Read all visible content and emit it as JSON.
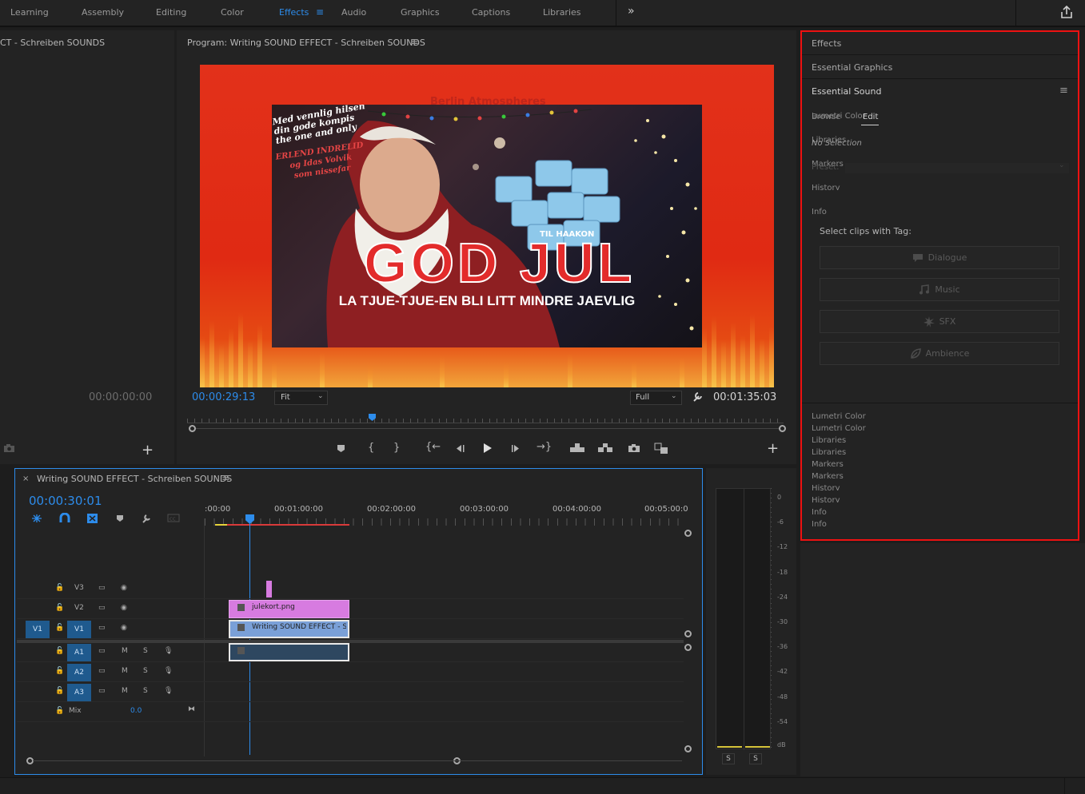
{
  "workspaces": {
    "tabs": [
      "Learning",
      "Assembly",
      "Editing",
      "Color",
      "Effects",
      "Audio",
      "Graphics",
      "Captions",
      "Libraries"
    ],
    "active": "Effects",
    "more_glyph": "»",
    "share_icon": "share-icon"
  },
  "source_panel": {
    "title": "CT - Schreiben SOUNDS",
    "timecode": "00:00:00:00"
  },
  "program": {
    "title": "Program: Writing SOUND EFFECT - Schreiben SOUNDS",
    "timecode": "00:00:29:13",
    "fit": "Fit",
    "resolution": "Full",
    "duration": "00:01:35:03",
    "image": {
      "top_text": "Berlin Atmospheres",
      "greeting_lines": [
        "Med vennlig hilsen",
        "din gode kompis",
        "the one and only"
      ],
      "names_lines": [
        "ERLEND INDRELID",
        "og Idas Volvik",
        "som nissefar"
      ],
      "to_text": "TIL HAAKON",
      "headline": "GOD JUL",
      "subline": "LA TJUE-TJUE-EN BLI LITT MINDRE JAEVLIG"
    }
  },
  "timeline": {
    "sequence": "Writing SOUND EFFECT - Schreiben SOUNDS",
    "timecode": "00:00:30:01",
    "ruler": [
      ":00:00",
      "00:01:00:00",
      "00:02:00:00",
      "00:03:00:00",
      "00:04:00:00",
      "00:05:00:0"
    ],
    "video_tracks": [
      "V3",
      "V2",
      "V1"
    ],
    "source_patch": "V1",
    "audio_tracks": [
      "A1",
      "A2",
      "A3"
    ],
    "mute": "M",
    "solo": "S",
    "mix_label": "Mix",
    "mix_value": "0.0",
    "clips": {
      "v2": "julekort.png",
      "v1": "Writing SOUND EFFECT - Sch"
    }
  },
  "meter": {
    "scale": [
      "0",
      "-6",
      "-12",
      "-18",
      "-24",
      "-30",
      "-36",
      "-42",
      "-48",
      "-54",
      "dB"
    ],
    "solo_buttons": [
      "S",
      "S"
    ]
  },
  "right_panels": {
    "effects": "Effects",
    "essential_graphics": "Essential Graphics",
    "essential_sound": "Essential Sound",
    "ghost_top": [
      "Lumetri Color",
      "Browse",
      "Edit",
      "Libraries",
      "No Selection",
      "Markers",
      "Preset:",
      "History",
      "Info"
    ],
    "select_tag_label": "Select clips with Tag:",
    "buttons": [
      {
        "label": "Dialogue",
        "icon": "speech-bubble-icon"
      },
      {
        "label": "Music",
        "icon": "music-note-icon"
      },
      {
        "label": "SFX",
        "icon": "starburst-icon"
      },
      {
        "label": "Ambience",
        "icon": "leaf-icon"
      }
    ],
    "ghost_bottom": [
      "Lumetri Color",
      "Lumetri Color",
      "Libraries",
      "Libraries",
      "Markers",
      "Markers",
      "History",
      "History",
      "Info",
      "Info"
    ]
  }
}
